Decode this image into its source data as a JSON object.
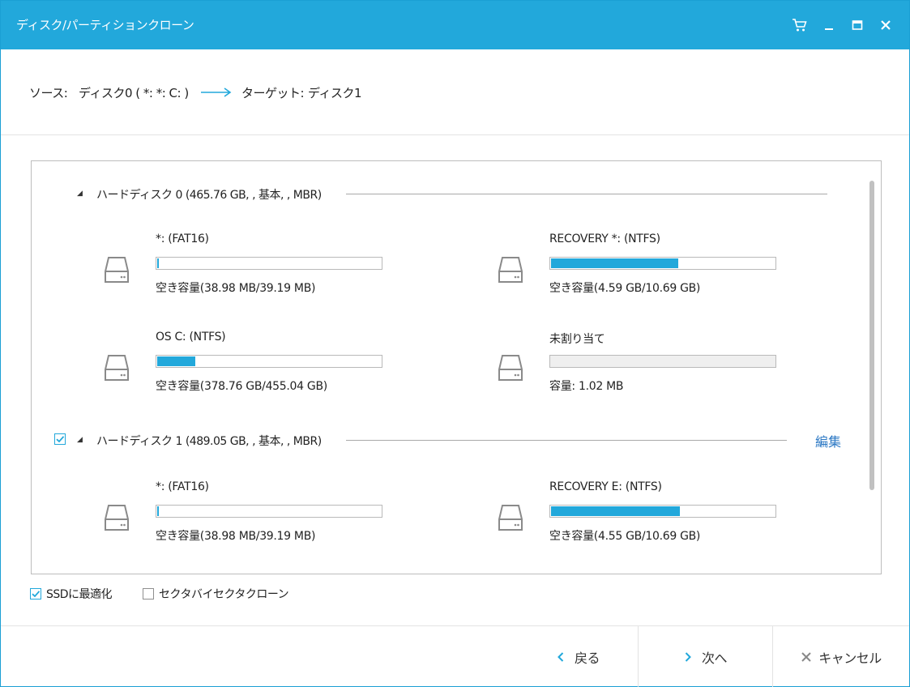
{
  "window": {
    "title": "ディスク/パーティションクローン"
  },
  "path": {
    "source_label": "ソース:",
    "source_value": "ディスク0 ( *: *: C: )",
    "target_label": "ターゲット:",
    "target_value": "ディスク1"
  },
  "disks": [
    {
      "label": "ハードディスク 0 (465.76 GB, , 基本, , MBR)",
      "checkbox_visible": false,
      "partitions": [
        {
          "name": "*: (FAT16)",
          "free": "空き容量(38.98 MB/39.19 MB)",
          "used_fraction": 0.005
        },
        {
          "name": "RECOVERY *: (NTFS)",
          "free": "空き容量(4.59 GB/10.69 GB)",
          "used_fraction": 0.57
        },
        {
          "name": "OS C: (NTFS)",
          "free": "空き容量(378.76 GB/455.04 GB)",
          "used_fraction": 0.17
        },
        {
          "name": "未割り当て",
          "free": "容量: 1.02 MB",
          "used_fraction": 0,
          "unallocated": true
        }
      ]
    },
    {
      "label": "ハードディスク 1 (489.05 GB, , 基本, , MBR)",
      "checkbox_visible": true,
      "checked": true,
      "edit_label": "編集",
      "partitions": [
        {
          "name": "*: (FAT16)",
          "free": "空き容量(38.98 MB/39.19 MB)",
          "used_fraction": 0.005
        },
        {
          "name": "RECOVERY E: (NTFS)",
          "free": "空き容量(4.55 GB/10.69 GB)",
          "used_fraction": 0.575
        }
      ]
    }
  ],
  "options": {
    "ssd_label": "SSDに最適化",
    "ssd_checked": true,
    "sector_label": "セクタバイセクタクローン",
    "sector_checked": false
  },
  "footer": {
    "back_label": "戻る",
    "next_label": "次へ",
    "cancel_label": "キャンセル"
  },
  "colors": {
    "accent": "#22a8db",
    "link": "#2c78c4"
  }
}
